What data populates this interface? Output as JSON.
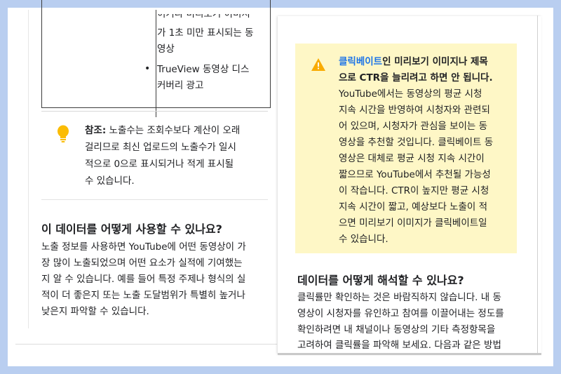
{
  "left": {
    "cut_text": "이거나 미리보기 이미지",
    "table_cell_lines": [
      "가 1초 미만 표시되는 동",
      "영상"
    ],
    "bullet_item_lines": [
      "TrueView 동영상 디스",
      "커버리 광고"
    ],
    "note": {
      "label": "참조:",
      "lines": [
        " 노출수는 조회수보다 계산이 오래",
        "걸리므로 최신 업로드의 노출수가 일시",
        "적으로 0으로 표시되거나 적게 표시될",
        "수 있습니다."
      ]
    },
    "heading": "이 데이터를 어떻게 사용할 수 있나요?",
    "paragraph_lines": [
      "노출 정보를 사용하면 YouTube에 어떤 동영상이 가",
      "장 많이 노출되었으며 어떤 요소가 실적에 기여했는",
      "지 알 수 있습니다. 예를 들어 특정 주제나 형식의 실",
      "적이 더 좋은지 또는 노출 도달범위가 특별히 높거나",
      "낮은지 파악할 수 있습니다."
    ]
  },
  "right": {
    "warning": {
      "link_text": "클릭베이트",
      "bold_line1_rest": "인 미리보기 이미지나 제목",
      "bold_line2": "으로 CTR을 늘리려고 하면 안 됩니다.",
      "lines": [
        "YouTube에서는 동영상의 평균 시청",
        "지속 시간을 반영하여 시청자와 관련되",
        "어 있으며, 시청자가 관심을 보이는 동",
        "영상을 추천할 것입니다. 클릭베이트 동",
        "영상은 대체로 평균 시청 지속 시간이",
        "짧으므로 YouTube에서 추천될 가능성",
        "이 작습니다. CTR이 높지만 평균 시청",
        "지속 시간이 짧고, 예상보다 노출이 적",
        "으면 미리보기 이미지가 클릭베이트일",
        "수 있습니다."
      ]
    },
    "heading": "데이터를 어떻게 해석할 수 있나요?",
    "paragraph_lines": [
      "클릭률만 확인하는 것은 바람직하지 않습니다. 내 동",
      "영상이 시청자를 유인하고 참여를 이끌어내는 정도를",
      "확인하려면 내 채널이나 동영상의 기타 측정항목을",
      "고려하여 클릭률을 파악해 보세요. 다음과 같은 방법"
    ]
  },
  "colors": {
    "background": "#b9cef0",
    "warning_background": "#fef7c6",
    "warning_icon": "#f9ab00",
    "bulb_icon": "#fbbc04",
    "link": "#1a73e8"
  },
  "icons": {
    "note": "lightbulb-icon",
    "warning": "warning-triangle-icon"
  }
}
